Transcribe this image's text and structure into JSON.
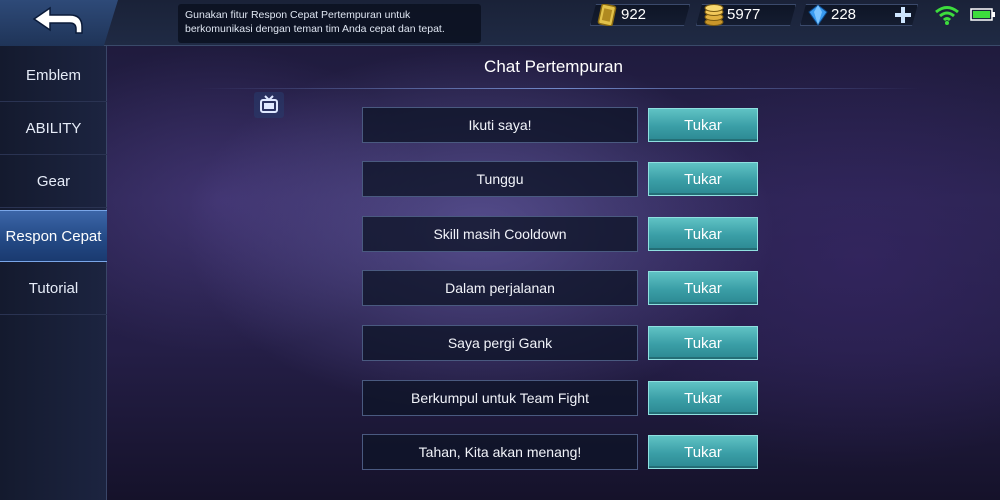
{
  "header": {
    "tip": "Gunakan fitur Respon Cepat Pertempuran untuk berkomunikasi dengan teman tim Anda cepat dan tepat.",
    "currencies": [
      {
        "icon": "ticket-icon",
        "value": "922"
      },
      {
        "icon": "coin-stack-icon",
        "value": "5977"
      },
      {
        "icon": "diamond-icon",
        "value": "228"
      }
    ]
  },
  "sidebar": {
    "items": [
      {
        "label": "Emblem",
        "active": false
      },
      {
        "label": "ABILITY",
        "active": false
      },
      {
        "label": "Gear",
        "active": false
      },
      {
        "label": "Respon Cepat",
        "active": true
      },
      {
        "label": "Tutorial",
        "active": false
      }
    ]
  },
  "main": {
    "title": "Chat Pertempuran",
    "swap_label": "Tukar",
    "messages": [
      "Ikuti saya!",
      "Tunggu",
      "Skill masih Cooldown",
      "Dalam perjalanan",
      "Saya pergi Gank",
      "Berkumpul untuk Team Fight",
      "Tahan, Kita akan menang!"
    ]
  },
  "colors": {
    "accent_teal": "#3a9ea6",
    "sidebar_active": "#2c5696",
    "wifi_green": "#3ddc3d",
    "battery_green": "#3ddc3d"
  }
}
